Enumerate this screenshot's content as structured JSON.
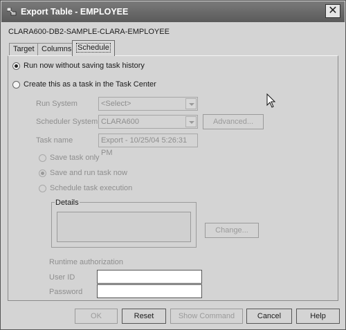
{
  "window": {
    "title": "Export Table - EMPLOYEE",
    "icons": {
      "app": "export-table-icon",
      "close": "close-icon"
    }
  },
  "context_label": "CLARA600-DB2-SAMPLE-CLARA-EMPLOYEE",
  "tabs": [
    {
      "label": "Target",
      "selected": false
    },
    {
      "label": "Columns",
      "selected": false
    },
    {
      "label": "Schedule",
      "selected": true
    }
  ],
  "schedule": {
    "run_now_label": "Run now without saving task history",
    "run_now_selected": true,
    "create_task_label": "Create this as a task in the Task Center",
    "create_task_selected": false,
    "run_system": {
      "label": "Run System",
      "value": "<Select>"
    },
    "scheduler_system": {
      "label": "Scheduler System",
      "value": "CLARA600"
    },
    "advanced_label": "Advanced...",
    "task_name": {
      "label": "Task name",
      "value": "Export - 10/25/04 5:26:31 PM"
    },
    "task_options": [
      {
        "label": "Save task only",
        "selected": false
      },
      {
        "label": "Save and run task now",
        "selected": true
      },
      {
        "label": "Schedule task execution",
        "selected": false
      }
    ],
    "details": {
      "label": "Details",
      "value": ""
    },
    "change_label": "Change...",
    "runtime_authorization": {
      "heading": "Runtime authorization",
      "user_id": {
        "label": "User ID",
        "value": ""
      },
      "password": {
        "label": "Password",
        "value": ""
      }
    }
  },
  "buttons": {
    "ok": "OK",
    "reset": "Reset",
    "show_command": "Show Command",
    "cancel": "Cancel",
    "help": "Help"
  },
  "colors": {
    "title_bar": "#666666",
    "dialog_background": "#d4d4d4",
    "disabled_text": "#8e8e8e"
  }
}
